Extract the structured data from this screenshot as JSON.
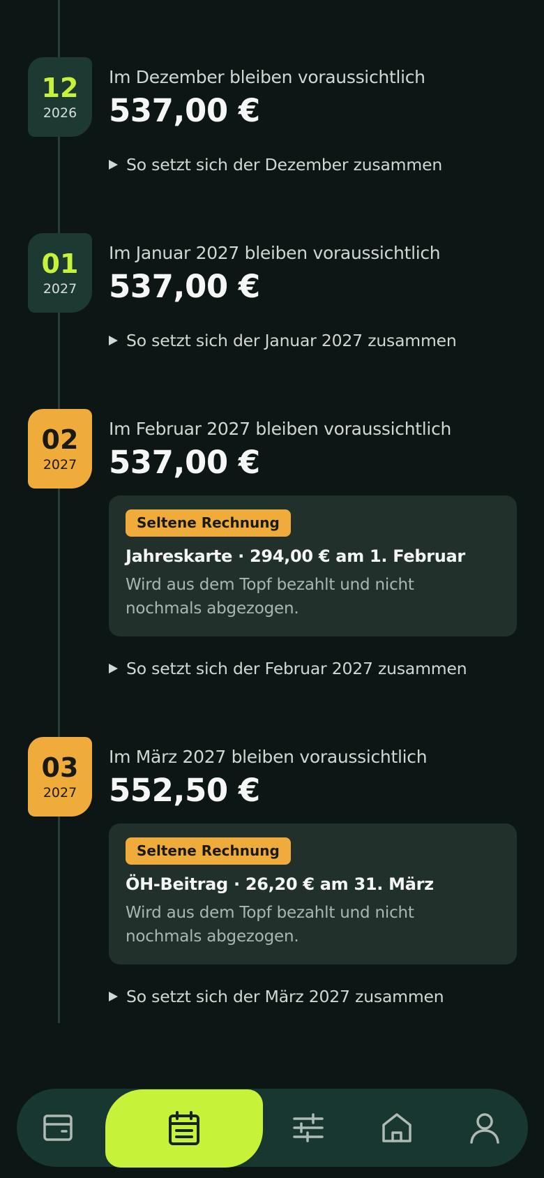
{
  "months": [
    {
      "num": "12",
      "year": "2026",
      "variant": "upcoming",
      "heading": "Im Dezember bleiben voraussichtlich",
      "amount": "537,00 €",
      "expander": "So setzt sich der Dezember zusammen"
    },
    {
      "num": "01",
      "year": "2027",
      "variant": "upcoming",
      "heading": "Im Januar 2027 bleiben voraussichtlich",
      "amount": "537,00 €",
      "expander": "So setzt sich der Januar 2027 zusammen"
    },
    {
      "num": "02",
      "year": "2027",
      "variant": "special",
      "heading": "Im Februar 2027 bleiben voraussichtlich",
      "amount": "537,00 €",
      "card": {
        "tag": "Seltene Rechnung",
        "title": "Jahreskarte · 294,00 € am 1. Februar",
        "desc_line1": "Wird aus dem Topf bezahlt und nicht",
        "desc_line2": "nochmals abgezogen."
      },
      "expander": "So setzt sich der Februar 2027 zusammen"
    },
    {
      "num": "03",
      "year": "2027",
      "variant": "special",
      "heading": "Im März 2027 bleiben voraussichtlich",
      "amount": "552,50 €",
      "card": {
        "tag": "Seltene Rechnung",
        "title": "ÖH-Beitrag · 26,20 € am 31. März",
        "desc_line1": "Wird aus dem Topf bezahlt und nicht",
        "desc_line2": "nochmals abgezogen."
      },
      "expander": "So setzt sich der März 2027 zusammen"
    }
  ],
  "nav": {
    "items": [
      {
        "icon": "wallet-icon",
        "active": false
      },
      {
        "icon": "calendar-icon",
        "active": true
      },
      {
        "icon": "sliders-icon",
        "active": false
      },
      {
        "icon": "home-icon",
        "active": false
      },
      {
        "icon": "user-icon",
        "active": false
      }
    ]
  },
  "colors": {
    "background": "#0c1614",
    "accent_lime": "#c7f23a",
    "accent_orange": "#f0ac3a",
    "badge_upcoming": "#1c3a32",
    "card_bg": "#21302b",
    "nav_bg": "#173730"
  }
}
